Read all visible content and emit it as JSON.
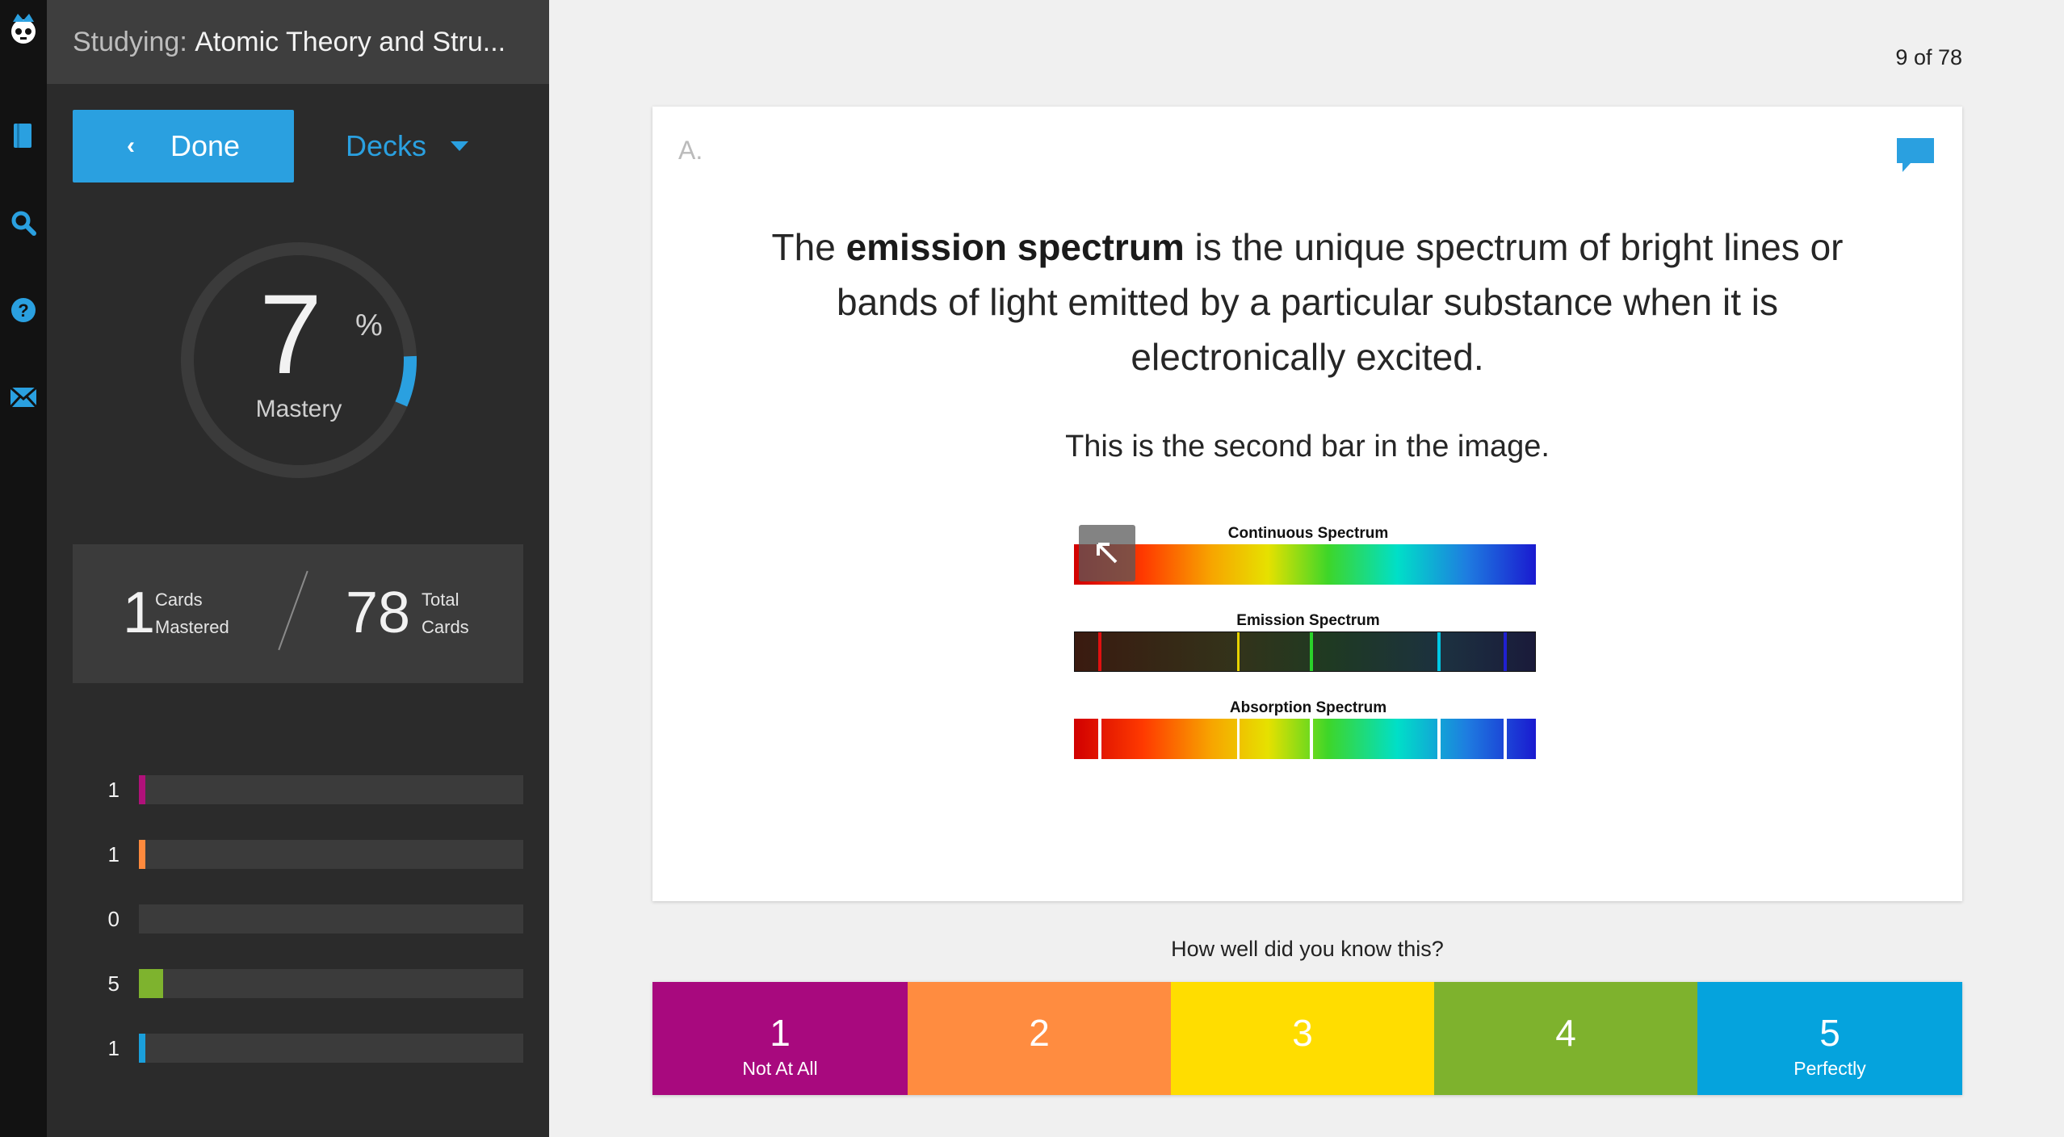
{
  "header": {
    "prefix": "Studying: ",
    "deck_title": "Atomic Theory and Stru..."
  },
  "nav": {
    "done_label": "Done",
    "decks_label": "Decks",
    "rail_icons": [
      "brainscape-logo-icon",
      "book-icon",
      "search-icon",
      "help-icon",
      "mail-icon"
    ]
  },
  "mastery": {
    "value": "7",
    "percent_sign": "%",
    "label": "Mastery",
    "fraction": 0.07
  },
  "stats": {
    "mastered_count": "1",
    "mastered_label_1": "Cards",
    "mastered_label_2": "Mastered",
    "total_count": "78",
    "total_label_1": "Total",
    "total_label_2": "Cards"
  },
  "confidence_bars": [
    {
      "count": "1",
      "fraction": 0.0128,
      "color": "#b0117a"
    },
    {
      "count": "1",
      "fraction": 0.0128,
      "color": "#ff8a3d"
    },
    {
      "count": "0",
      "fraction": 0,
      "color": "#ffdd00"
    },
    {
      "count": "5",
      "fraction": 0.064,
      "color": "#7eb32e"
    },
    {
      "count": "1",
      "fraction": 0.0128,
      "color": "#1a9fdb"
    }
  ],
  "card": {
    "counter": "9 of 78",
    "side_label": "A.",
    "answer_bold": "emission spectrum",
    "answer_pre": "The ",
    "answer_post": " is the unique spectrum of bright lines or bands of light emitted by a particular substance when it is electronically excited.",
    "note": "This is the second bar in the image.",
    "image": {
      "title_1": "Continuous Spectrum",
      "title_2": "Emission Spectrum",
      "title_3": "Absorption Spectrum"
    }
  },
  "rating": {
    "prompt": "How well did you know this?",
    "options": [
      {
        "number": "1",
        "label": "Not At All",
        "color": "#a8097e"
      },
      {
        "number": "2",
        "label": "",
        "color": "#ff8c40"
      },
      {
        "number": "3",
        "label": "",
        "color": "#ffdd00"
      },
      {
        "number": "4",
        "label": "",
        "color": "#7eb22d"
      },
      {
        "number": "5",
        "label": "Perfectly",
        "color": "#05a3dd"
      }
    ]
  },
  "colors": {
    "accent": "#2aa0e0",
    "sidebar_bg": "#2b2b2b",
    "rail_bg": "#121212"
  }
}
